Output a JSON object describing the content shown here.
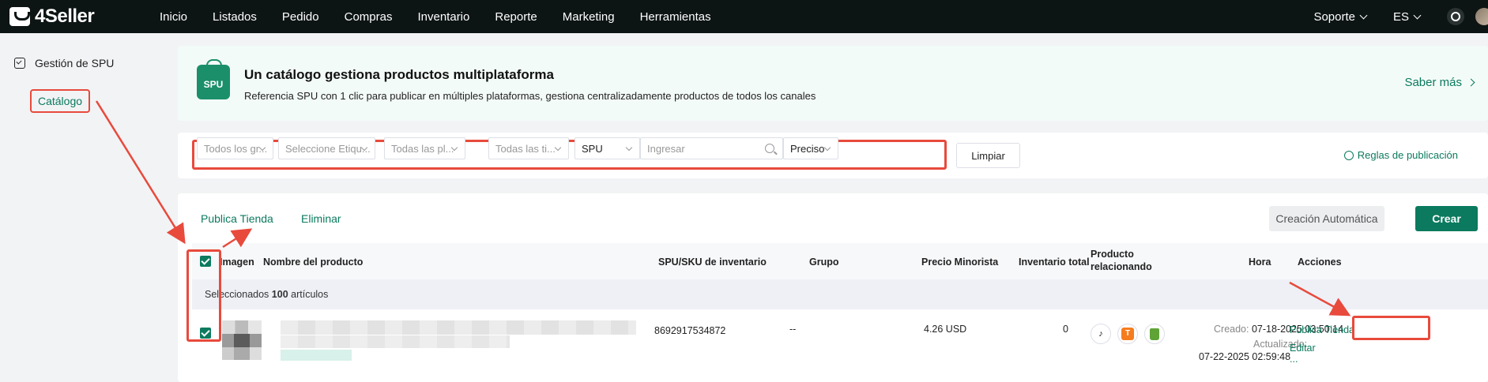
{
  "topbar": {
    "logo": "4Seller",
    "nav": [
      "Inicio",
      "Listados",
      "Pedido",
      "Compras",
      "Inventario",
      "Reporte",
      "Marketing",
      "Herramientas"
    ],
    "support": "Soporte",
    "language": "ES"
  },
  "sidebar": {
    "section": "Gestión de SPU",
    "item": "Catálogo"
  },
  "banner": {
    "icon_label": "SPU",
    "title": "Un catálogo gestiona productos multiplataforma",
    "subtitle": "Referencia SPU con 1 clic para publicar en múltiples plataformas, gestiona centralizadamente productos de todos los canales",
    "learn_more": "Saber más"
  },
  "filters": {
    "group": "Todos los gr...",
    "tags": "Seleccione Etiqu...",
    "platforms": "Todas las pl...",
    "types": "Todas las ti...",
    "search_field": "SPU",
    "search_placeholder": "Ingresar",
    "match": "Preciso",
    "clear": "Limpiar",
    "rules": "Reglas de publicación"
  },
  "actions": {
    "publish_store": "Publica Tienda",
    "delete": "Eliminar",
    "auto_create": "Creación Automática",
    "create": "Crear"
  },
  "table": {
    "headers": {
      "image": "Imagen",
      "name": "Nombre del producto",
      "spu_sku": "SPU/SKU de inventario",
      "group": "Grupo",
      "retail_price": "Precio Minorista",
      "total_inventory": "Inventario total",
      "related_line1": "Producto",
      "related_line2": "relacionando",
      "time": "Hora",
      "actions": "Acciones"
    },
    "selection": {
      "prefix": "Seleccionados",
      "count": "100",
      "suffix": "artículos"
    },
    "rows": [
      {
        "sku": "8692917534872",
        "group": "--",
        "price": "4.26 USD",
        "inventory": "0",
        "created_label": "Creado:",
        "created": "07-18-2025 03:50:14",
        "updated_label": "Actualizado:",
        "updated": "07-22-2025 02:59:48",
        "action_publish": "Publica Tienda",
        "action_edit": "Editar",
        "action_more": "..."
      }
    ]
  },
  "colors": {
    "brand": "#0b7a5e",
    "topbar": "#0d1414",
    "annotation": "#e84a3c"
  }
}
